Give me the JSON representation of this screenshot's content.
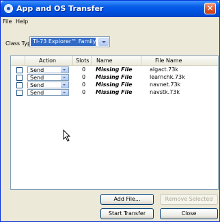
{
  "window": {
    "title": "App and OS Transfer"
  },
  "menu": [
    "File",
    "Help"
  ],
  "class_type": {
    "label": "Class Type",
    "selected": "TI-73 Explorer™ Family"
  },
  "table": {
    "headers": [
      "Action",
      "Slots",
      "Name",
      "File Name"
    ],
    "rows": [
      {
        "action": "Send",
        "slots": "0",
        "name": "Missing File",
        "file": "algact.73k"
      },
      {
        "action": "Send",
        "slots": "0",
        "name": "Missing File",
        "file": "learnchk.73k"
      },
      {
        "action": "Send",
        "slots": "0",
        "name": "Missing File",
        "file": "navnet.73k"
      },
      {
        "action": "Send",
        "slots": "0",
        "name": "Missing File",
        "file": "navstk.73k"
      }
    ]
  },
  "buttons": {
    "add_file": "Add File...",
    "remove_selected": "Remove Selected",
    "start_transfer": "Start Transfer",
    "close": "Close"
  },
  "colors": {
    "titlebar": "#0054e3",
    "selection": "#316ac5",
    "window_bg": "#ece9d8"
  }
}
